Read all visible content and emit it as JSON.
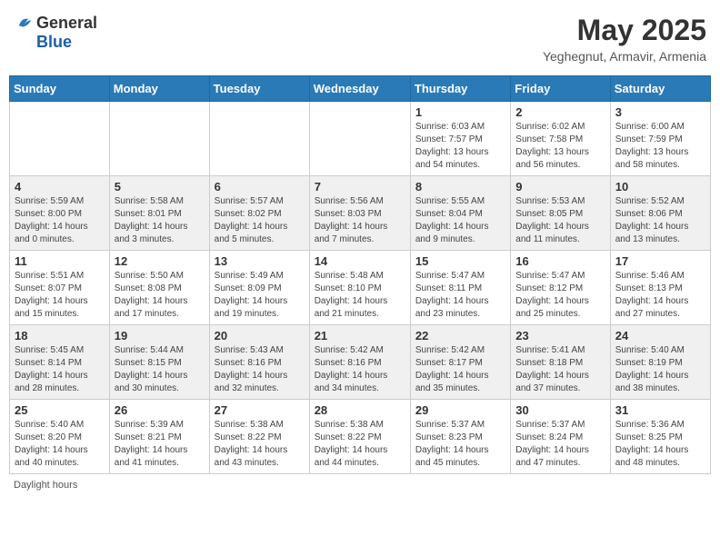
{
  "header": {
    "logo_general": "General",
    "logo_blue": "Blue",
    "title": "May 2025",
    "subtitle": "Yeghegnut, Armavir, Armenia"
  },
  "days_of_week": [
    "Sunday",
    "Monday",
    "Tuesday",
    "Wednesday",
    "Thursday",
    "Friday",
    "Saturday"
  ],
  "weeks": [
    [
      {
        "day": "",
        "info": ""
      },
      {
        "day": "",
        "info": ""
      },
      {
        "day": "",
        "info": ""
      },
      {
        "day": "",
        "info": ""
      },
      {
        "day": "1",
        "info": "Sunrise: 6:03 AM\nSunset: 7:57 PM\nDaylight: 13 hours\nand 54 minutes."
      },
      {
        "day": "2",
        "info": "Sunrise: 6:02 AM\nSunset: 7:58 PM\nDaylight: 13 hours\nand 56 minutes."
      },
      {
        "day": "3",
        "info": "Sunrise: 6:00 AM\nSunset: 7:59 PM\nDaylight: 13 hours\nand 58 minutes."
      }
    ],
    [
      {
        "day": "4",
        "info": "Sunrise: 5:59 AM\nSunset: 8:00 PM\nDaylight: 14 hours\nand 0 minutes."
      },
      {
        "day": "5",
        "info": "Sunrise: 5:58 AM\nSunset: 8:01 PM\nDaylight: 14 hours\nand 3 minutes."
      },
      {
        "day": "6",
        "info": "Sunrise: 5:57 AM\nSunset: 8:02 PM\nDaylight: 14 hours\nand 5 minutes."
      },
      {
        "day": "7",
        "info": "Sunrise: 5:56 AM\nSunset: 8:03 PM\nDaylight: 14 hours\nand 7 minutes."
      },
      {
        "day": "8",
        "info": "Sunrise: 5:55 AM\nSunset: 8:04 PM\nDaylight: 14 hours\nand 9 minutes."
      },
      {
        "day": "9",
        "info": "Sunrise: 5:53 AM\nSunset: 8:05 PM\nDaylight: 14 hours\nand 11 minutes."
      },
      {
        "day": "10",
        "info": "Sunrise: 5:52 AM\nSunset: 8:06 PM\nDaylight: 14 hours\nand 13 minutes."
      }
    ],
    [
      {
        "day": "11",
        "info": "Sunrise: 5:51 AM\nSunset: 8:07 PM\nDaylight: 14 hours\nand 15 minutes."
      },
      {
        "day": "12",
        "info": "Sunrise: 5:50 AM\nSunset: 8:08 PM\nDaylight: 14 hours\nand 17 minutes."
      },
      {
        "day": "13",
        "info": "Sunrise: 5:49 AM\nSunset: 8:09 PM\nDaylight: 14 hours\nand 19 minutes."
      },
      {
        "day": "14",
        "info": "Sunrise: 5:48 AM\nSunset: 8:10 PM\nDaylight: 14 hours\nand 21 minutes."
      },
      {
        "day": "15",
        "info": "Sunrise: 5:47 AM\nSunset: 8:11 PM\nDaylight: 14 hours\nand 23 minutes."
      },
      {
        "day": "16",
        "info": "Sunrise: 5:47 AM\nSunset: 8:12 PM\nDaylight: 14 hours\nand 25 minutes."
      },
      {
        "day": "17",
        "info": "Sunrise: 5:46 AM\nSunset: 8:13 PM\nDaylight: 14 hours\nand 27 minutes."
      }
    ],
    [
      {
        "day": "18",
        "info": "Sunrise: 5:45 AM\nSunset: 8:14 PM\nDaylight: 14 hours\nand 28 minutes."
      },
      {
        "day": "19",
        "info": "Sunrise: 5:44 AM\nSunset: 8:15 PM\nDaylight: 14 hours\nand 30 minutes."
      },
      {
        "day": "20",
        "info": "Sunrise: 5:43 AM\nSunset: 8:16 PM\nDaylight: 14 hours\nand 32 minutes."
      },
      {
        "day": "21",
        "info": "Sunrise: 5:42 AM\nSunset: 8:16 PM\nDaylight: 14 hours\nand 34 minutes."
      },
      {
        "day": "22",
        "info": "Sunrise: 5:42 AM\nSunset: 8:17 PM\nDaylight: 14 hours\nand 35 minutes."
      },
      {
        "day": "23",
        "info": "Sunrise: 5:41 AM\nSunset: 8:18 PM\nDaylight: 14 hours\nand 37 minutes."
      },
      {
        "day": "24",
        "info": "Sunrise: 5:40 AM\nSunset: 8:19 PM\nDaylight: 14 hours\nand 38 minutes."
      }
    ],
    [
      {
        "day": "25",
        "info": "Sunrise: 5:40 AM\nSunset: 8:20 PM\nDaylight: 14 hours\nand 40 minutes."
      },
      {
        "day": "26",
        "info": "Sunrise: 5:39 AM\nSunset: 8:21 PM\nDaylight: 14 hours\nand 41 minutes."
      },
      {
        "day": "27",
        "info": "Sunrise: 5:38 AM\nSunset: 8:22 PM\nDaylight: 14 hours\nand 43 minutes."
      },
      {
        "day": "28",
        "info": "Sunrise: 5:38 AM\nSunset: 8:22 PM\nDaylight: 14 hours\nand 44 minutes."
      },
      {
        "day": "29",
        "info": "Sunrise: 5:37 AM\nSunset: 8:23 PM\nDaylight: 14 hours\nand 45 minutes."
      },
      {
        "day": "30",
        "info": "Sunrise: 5:37 AM\nSunset: 8:24 PM\nDaylight: 14 hours\nand 47 minutes."
      },
      {
        "day": "31",
        "info": "Sunrise: 5:36 AM\nSunset: 8:25 PM\nDaylight: 14 hours\nand 48 minutes."
      }
    ]
  ],
  "footer": {
    "daylight_label": "Daylight hours"
  }
}
